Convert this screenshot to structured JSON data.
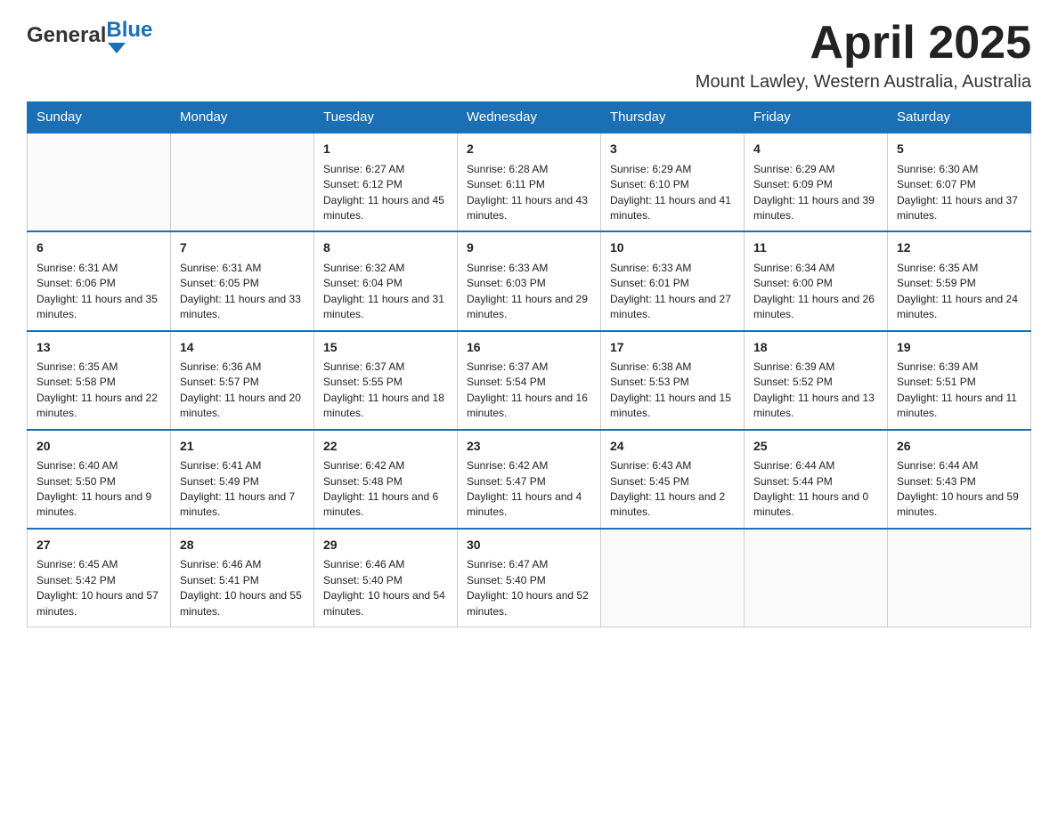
{
  "header": {
    "logo_general": "General",
    "logo_blue": "Blue",
    "month_year": "April 2025",
    "location": "Mount Lawley, Western Australia, Australia"
  },
  "days_of_week": [
    "Sunday",
    "Monday",
    "Tuesday",
    "Wednesday",
    "Thursday",
    "Friday",
    "Saturday"
  ],
  "weeks": [
    [
      {
        "day": "",
        "sunrise": "",
        "sunset": "",
        "daylight": ""
      },
      {
        "day": "",
        "sunrise": "",
        "sunset": "",
        "daylight": ""
      },
      {
        "day": "1",
        "sunrise": "Sunrise: 6:27 AM",
        "sunset": "Sunset: 6:12 PM",
        "daylight": "Daylight: 11 hours and 45 minutes."
      },
      {
        "day": "2",
        "sunrise": "Sunrise: 6:28 AM",
        "sunset": "Sunset: 6:11 PM",
        "daylight": "Daylight: 11 hours and 43 minutes."
      },
      {
        "day": "3",
        "sunrise": "Sunrise: 6:29 AM",
        "sunset": "Sunset: 6:10 PM",
        "daylight": "Daylight: 11 hours and 41 minutes."
      },
      {
        "day": "4",
        "sunrise": "Sunrise: 6:29 AM",
        "sunset": "Sunset: 6:09 PM",
        "daylight": "Daylight: 11 hours and 39 minutes."
      },
      {
        "day": "5",
        "sunrise": "Sunrise: 6:30 AM",
        "sunset": "Sunset: 6:07 PM",
        "daylight": "Daylight: 11 hours and 37 minutes."
      }
    ],
    [
      {
        "day": "6",
        "sunrise": "Sunrise: 6:31 AM",
        "sunset": "Sunset: 6:06 PM",
        "daylight": "Daylight: 11 hours and 35 minutes."
      },
      {
        "day": "7",
        "sunrise": "Sunrise: 6:31 AM",
        "sunset": "Sunset: 6:05 PM",
        "daylight": "Daylight: 11 hours and 33 minutes."
      },
      {
        "day": "8",
        "sunrise": "Sunrise: 6:32 AM",
        "sunset": "Sunset: 6:04 PM",
        "daylight": "Daylight: 11 hours and 31 minutes."
      },
      {
        "day": "9",
        "sunrise": "Sunrise: 6:33 AM",
        "sunset": "Sunset: 6:03 PM",
        "daylight": "Daylight: 11 hours and 29 minutes."
      },
      {
        "day": "10",
        "sunrise": "Sunrise: 6:33 AM",
        "sunset": "Sunset: 6:01 PM",
        "daylight": "Daylight: 11 hours and 27 minutes."
      },
      {
        "day": "11",
        "sunrise": "Sunrise: 6:34 AM",
        "sunset": "Sunset: 6:00 PM",
        "daylight": "Daylight: 11 hours and 26 minutes."
      },
      {
        "day": "12",
        "sunrise": "Sunrise: 6:35 AM",
        "sunset": "Sunset: 5:59 PM",
        "daylight": "Daylight: 11 hours and 24 minutes."
      }
    ],
    [
      {
        "day": "13",
        "sunrise": "Sunrise: 6:35 AM",
        "sunset": "Sunset: 5:58 PM",
        "daylight": "Daylight: 11 hours and 22 minutes."
      },
      {
        "day": "14",
        "sunrise": "Sunrise: 6:36 AM",
        "sunset": "Sunset: 5:57 PM",
        "daylight": "Daylight: 11 hours and 20 minutes."
      },
      {
        "day": "15",
        "sunrise": "Sunrise: 6:37 AM",
        "sunset": "Sunset: 5:55 PM",
        "daylight": "Daylight: 11 hours and 18 minutes."
      },
      {
        "day": "16",
        "sunrise": "Sunrise: 6:37 AM",
        "sunset": "Sunset: 5:54 PM",
        "daylight": "Daylight: 11 hours and 16 minutes."
      },
      {
        "day": "17",
        "sunrise": "Sunrise: 6:38 AM",
        "sunset": "Sunset: 5:53 PM",
        "daylight": "Daylight: 11 hours and 15 minutes."
      },
      {
        "day": "18",
        "sunrise": "Sunrise: 6:39 AM",
        "sunset": "Sunset: 5:52 PM",
        "daylight": "Daylight: 11 hours and 13 minutes."
      },
      {
        "day": "19",
        "sunrise": "Sunrise: 6:39 AM",
        "sunset": "Sunset: 5:51 PM",
        "daylight": "Daylight: 11 hours and 11 minutes."
      }
    ],
    [
      {
        "day": "20",
        "sunrise": "Sunrise: 6:40 AM",
        "sunset": "Sunset: 5:50 PM",
        "daylight": "Daylight: 11 hours and 9 minutes."
      },
      {
        "day": "21",
        "sunrise": "Sunrise: 6:41 AM",
        "sunset": "Sunset: 5:49 PM",
        "daylight": "Daylight: 11 hours and 7 minutes."
      },
      {
        "day": "22",
        "sunrise": "Sunrise: 6:42 AM",
        "sunset": "Sunset: 5:48 PM",
        "daylight": "Daylight: 11 hours and 6 minutes."
      },
      {
        "day": "23",
        "sunrise": "Sunrise: 6:42 AM",
        "sunset": "Sunset: 5:47 PM",
        "daylight": "Daylight: 11 hours and 4 minutes."
      },
      {
        "day": "24",
        "sunrise": "Sunrise: 6:43 AM",
        "sunset": "Sunset: 5:45 PM",
        "daylight": "Daylight: 11 hours and 2 minutes."
      },
      {
        "day": "25",
        "sunrise": "Sunrise: 6:44 AM",
        "sunset": "Sunset: 5:44 PM",
        "daylight": "Daylight: 11 hours and 0 minutes."
      },
      {
        "day": "26",
        "sunrise": "Sunrise: 6:44 AM",
        "sunset": "Sunset: 5:43 PM",
        "daylight": "Daylight: 10 hours and 59 minutes."
      }
    ],
    [
      {
        "day": "27",
        "sunrise": "Sunrise: 6:45 AM",
        "sunset": "Sunset: 5:42 PM",
        "daylight": "Daylight: 10 hours and 57 minutes."
      },
      {
        "day": "28",
        "sunrise": "Sunrise: 6:46 AM",
        "sunset": "Sunset: 5:41 PM",
        "daylight": "Daylight: 10 hours and 55 minutes."
      },
      {
        "day": "29",
        "sunrise": "Sunrise: 6:46 AM",
        "sunset": "Sunset: 5:40 PM",
        "daylight": "Daylight: 10 hours and 54 minutes."
      },
      {
        "day": "30",
        "sunrise": "Sunrise: 6:47 AM",
        "sunset": "Sunset: 5:40 PM",
        "daylight": "Daylight: 10 hours and 52 minutes."
      },
      {
        "day": "",
        "sunrise": "",
        "sunset": "",
        "daylight": ""
      },
      {
        "day": "",
        "sunrise": "",
        "sunset": "",
        "daylight": ""
      },
      {
        "day": "",
        "sunrise": "",
        "sunset": "",
        "daylight": ""
      }
    ]
  ]
}
